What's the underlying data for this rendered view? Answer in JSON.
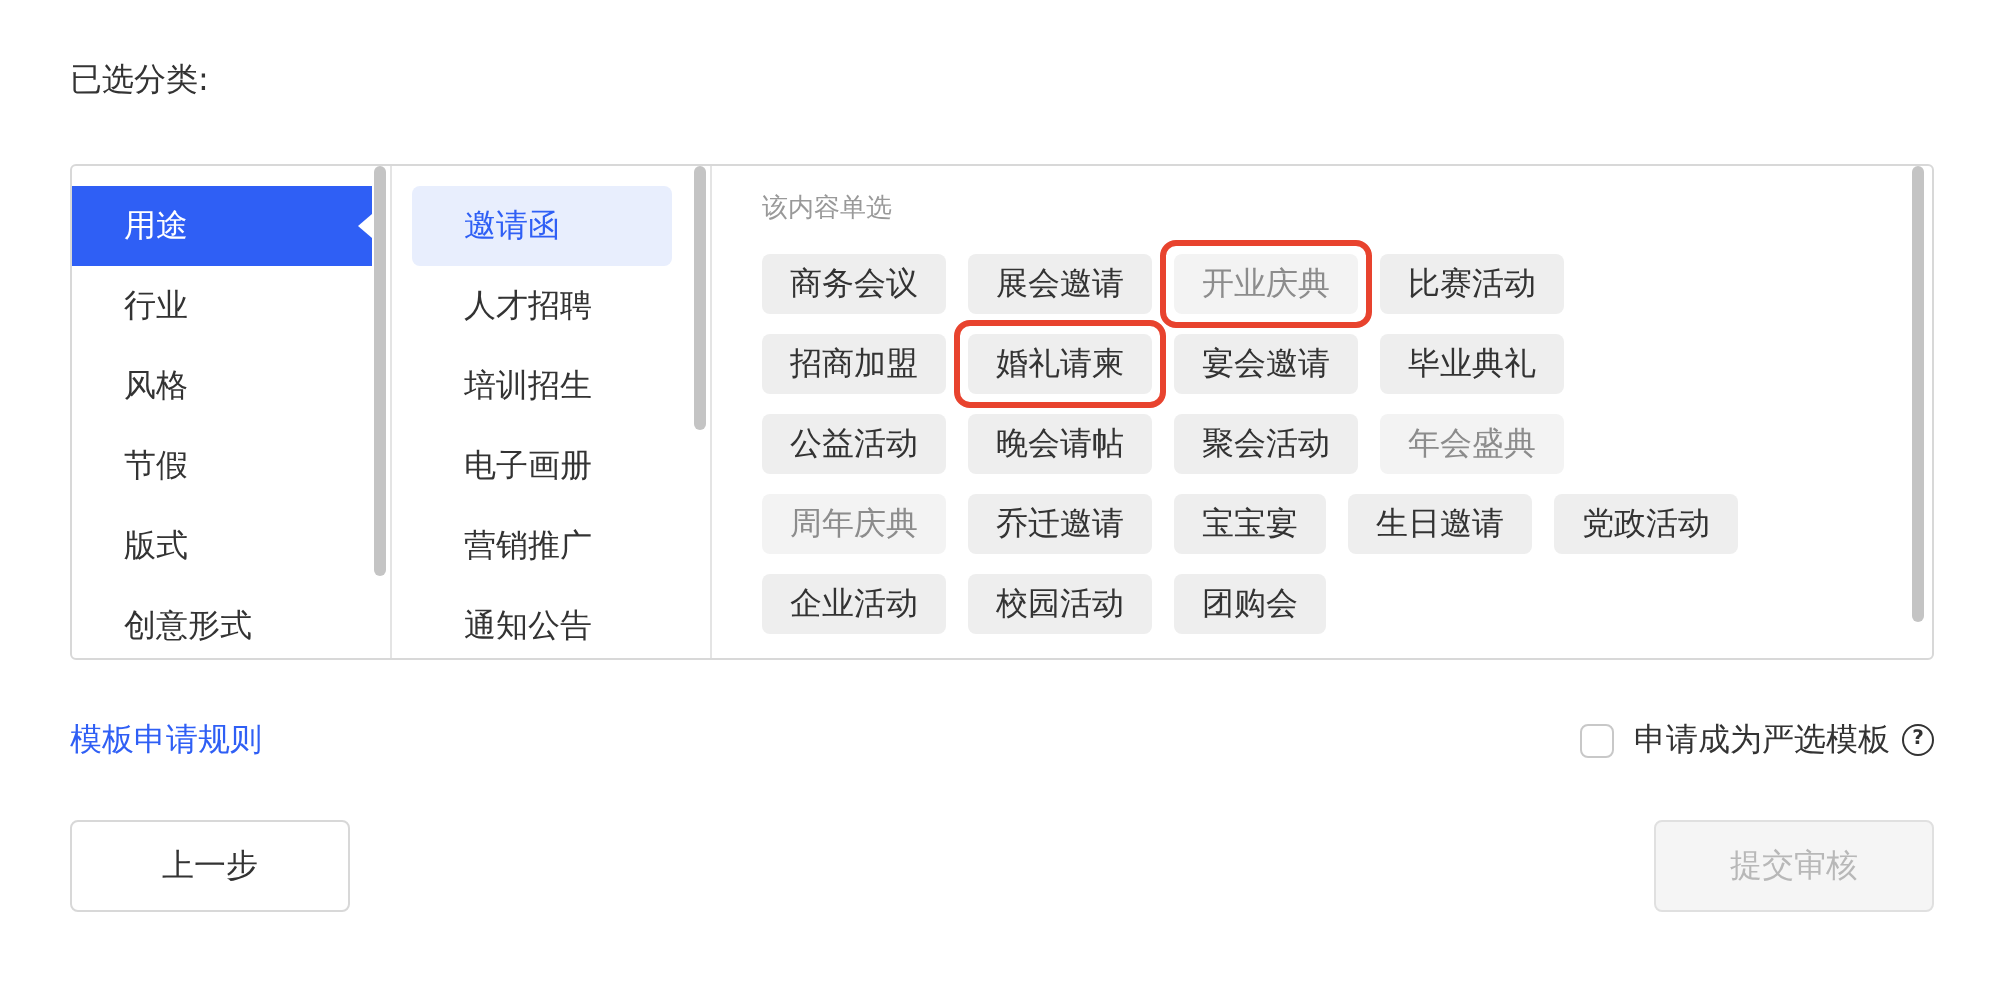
{
  "heading": "已选分类:",
  "categories": [
    {
      "label": "用途",
      "selected": true
    },
    {
      "label": "行业",
      "selected": false
    },
    {
      "label": "风格",
      "selected": false
    },
    {
      "label": "节假",
      "selected": false
    },
    {
      "label": "版式",
      "selected": false
    },
    {
      "label": "创意形式",
      "selected": false
    }
  ],
  "subcategories": [
    {
      "label": "邀请函",
      "selected": true
    },
    {
      "label": "人才招聘",
      "selected": false
    },
    {
      "label": "培训招生",
      "selected": false
    },
    {
      "label": "电子画册",
      "selected": false
    },
    {
      "label": "营销推广",
      "selected": false
    },
    {
      "label": "通知公告",
      "selected": false
    }
  ],
  "tag_hint": "该内容单选",
  "tags": [
    {
      "label": "商务会议",
      "disabled": false,
      "highlighted": false
    },
    {
      "label": "展会邀请",
      "disabled": false,
      "highlighted": false
    },
    {
      "label": "开业庆典",
      "disabled": true,
      "highlighted": true
    },
    {
      "label": "比赛活动",
      "disabled": false,
      "highlighted": false
    },
    {
      "label": "招商加盟",
      "disabled": false,
      "highlighted": false
    },
    {
      "label": "婚礼请柬",
      "disabled": false,
      "highlighted": true
    },
    {
      "label": "宴会邀请",
      "disabled": false,
      "highlighted": false
    },
    {
      "label": "毕业典礼",
      "disabled": false,
      "highlighted": false
    },
    {
      "label": "公益活动",
      "disabled": false,
      "highlighted": false
    },
    {
      "label": "晚会请帖",
      "disabled": false,
      "highlighted": false
    },
    {
      "label": "聚会活动",
      "disabled": false,
      "highlighted": false
    },
    {
      "label": "年会盛典",
      "disabled": true,
      "highlighted": false
    },
    {
      "label": "周年庆典",
      "disabled": true,
      "highlighted": false
    },
    {
      "label": "乔迁邀请",
      "disabled": false,
      "highlighted": false
    },
    {
      "label": "宝宝宴",
      "disabled": false,
      "highlighted": false
    },
    {
      "label": "生日邀请",
      "disabled": false,
      "highlighted": false
    },
    {
      "label": "党政活动",
      "disabled": false,
      "highlighted": false
    },
    {
      "label": "企业活动",
      "disabled": false,
      "highlighted": false
    },
    {
      "label": "校园活动",
      "disabled": false,
      "highlighted": false
    },
    {
      "label": "团购会",
      "disabled": false,
      "highlighted": false
    }
  ],
  "rules_link": "模板申请规则",
  "premium_option": {
    "label": "申请成为严选模板",
    "checked": false,
    "help": "?"
  },
  "buttons": [
    {
      "label": "上一步",
      "disabled": false
    },
    {
      "label": "提交审核",
      "disabled": true
    }
  ]
}
